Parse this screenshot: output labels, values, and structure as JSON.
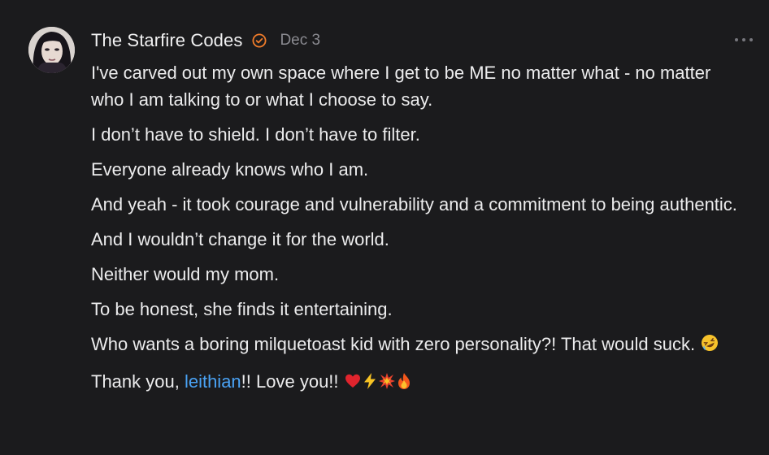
{
  "comment": {
    "author": "The Starfire Codes",
    "date": "Dec 3",
    "verified_icon": "check-circle-icon",
    "more_icon": "ellipsis-icon",
    "colors": {
      "background": "#1b1b1d",
      "text": "#ececed",
      "muted": "#8a8a90",
      "verified": "#f07c2a",
      "mention": "#4aa3f5"
    },
    "paragraphs": [
      "I've carved out my own space where I get to be ME no matter what - no matter who I am talking to or what I choose to say.",
      "I don’t have to shield. I don’t have to filter.",
      "Everyone already knows who I am.",
      "And yeah - it took courage and vulnerability and a commitment to being authentic.",
      "And I wouldn’t change it for the world.",
      "Neither would my mom.",
      "To be honest, she finds it entertaining.",
      "Who wants a boring milquetoast kid with zero personality?! That would suck."
    ],
    "last_line": {
      "prefix": "Thank you, ",
      "mention": "leithian",
      "suffix": "!! Love you!!"
    },
    "emojis": {
      "laugh": "rolling-on-floor-laughing-emoji",
      "heart": "red-heart-emoji",
      "bolt": "lightning-emoji",
      "burst": "collision-emoji",
      "fire": "fire-emoji"
    }
  }
}
